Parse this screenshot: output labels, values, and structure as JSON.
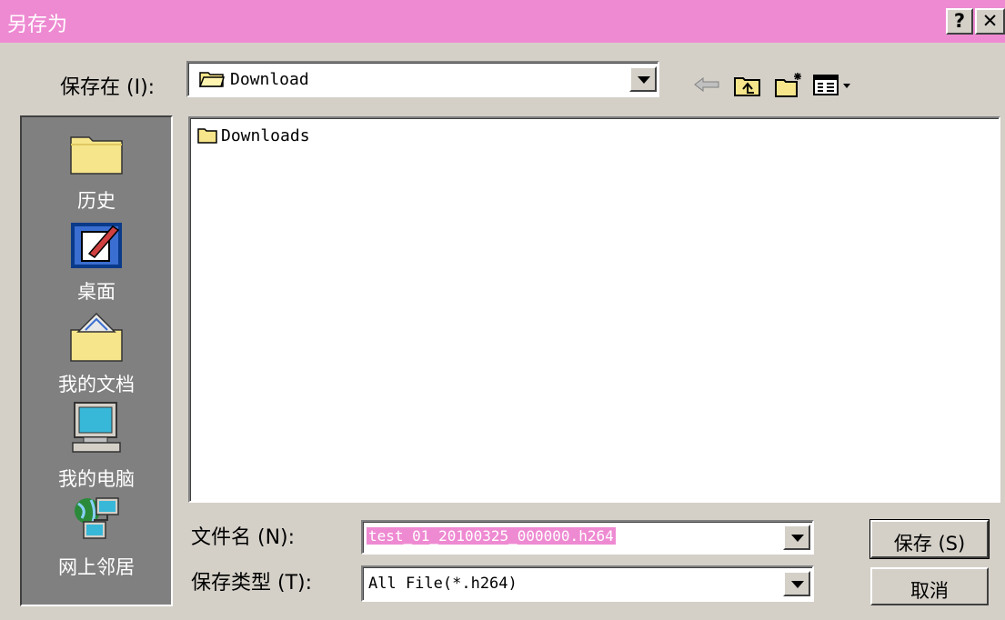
{
  "dialog": {
    "title": "另存为",
    "help_label": "?",
    "close_label": "✕"
  },
  "toolbar": {
    "save_in_label": "保存在 (I):",
    "save_in_value": "Download",
    "back_icon": "back-arrow-icon",
    "up_icon": "up-folder-icon",
    "new_folder_icon": "new-folder-icon",
    "view_menu_icon": "view-menu-icon"
  },
  "places": [
    {
      "label": "历史",
      "icon": "history-folder-icon"
    },
    {
      "label": "桌面",
      "icon": "desktop-icon"
    },
    {
      "label": "我的文档",
      "icon": "my-documents-icon"
    },
    {
      "label": "我的电脑",
      "icon": "my-computer-icon"
    },
    {
      "label": "网上邻居",
      "icon": "network-icon"
    }
  ],
  "files": [
    {
      "name": "Downloads",
      "icon": "folder-icon"
    }
  ],
  "filename": {
    "label": "文件名 (N):",
    "value": "test_01_20100325_000000.h264"
  },
  "filetype": {
    "label": "保存类型 (T):",
    "value": "All File(*.h264)"
  },
  "buttons": {
    "save_label": "保存 (S)",
    "cancel_label": "取消"
  },
  "colors": {
    "titlebar": "#ee8ad2",
    "dialog_bg": "#d4d0c8",
    "places_bg": "#808080",
    "selection": "#ee8ad2"
  }
}
